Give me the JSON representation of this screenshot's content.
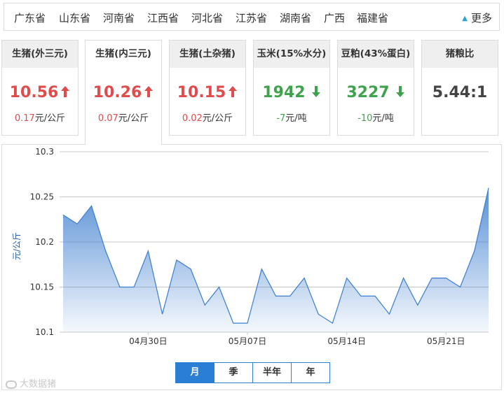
{
  "provinces": [
    "广东省",
    "山东省",
    "河南省",
    "江西省",
    "河北省",
    "江苏省",
    "湖南省",
    "广西",
    "福建省"
  ],
  "more_label": "更多",
  "cards": [
    {
      "title": "生猪(外三元)",
      "price": "10.56",
      "trend": "up",
      "change": "0.17",
      "unit": "元/公斤"
    },
    {
      "title": "生猪(内三元)",
      "price": "10.26",
      "trend": "up",
      "change": "0.07",
      "unit": "元/公斤"
    },
    {
      "title": "生猪(土杂猪)",
      "price": "10.15",
      "trend": "up",
      "change": "0.02",
      "unit": "元/公斤"
    },
    {
      "title": "玉米(15%水分)",
      "price": "1942",
      "trend": "down",
      "change": "-7",
      "unit": "元/吨"
    },
    {
      "title": "豆粕(43%蛋白)",
      "price": "3227",
      "trend": "down",
      "change": "-10",
      "unit": "元/吨"
    },
    {
      "title": "猪粮比",
      "price": "5.44:1",
      "trend": "flat",
      "change": "",
      "unit": ""
    }
  ],
  "active_card": 1,
  "colors": {
    "up": "#e04b4b",
    "down": "#3fa34d",
    "accent": "#2a7fd4",
    "line": "#3b7dcf"
  },
  "chart_data": {
    "type": "area",
    "ylabel": "元/公斤",
    "xlabel": "",
    "ylim": [
      10.1,
      10.3
    ],
    "yticks": [
      "10.3",
      "10.25",
      "10.2",
      "10.15",
      "10.1"
    ],
    "x": [
      "04-24",
      "04-25",
      "04-26",
      "04-27",
      "04-28",
      "04-29",
      "04-30",
      "05-01",
      "05-02",
      "05-03",
      "05-04",
      "05-05",
      "05-06",
      "05-07",
      "05-08",
      "05-09",
      "05-10",
      "05-11",
      "05-12",
      "05-13",
      "05-14",
      "05-15",
      "05-16",
      "05-17",
      "05-18",
      "05-19",
      "05-20",
      "05-21",
      "05-22",
      "05-23",
      "05-24"
    ],
    "xticks": [
      {
        "x": "04-30",
        "label": "04月30日"
      },
      {
        "x": "05-07",
        "label": "05月07日"
      },
      {
        "x": "05-14",
        "label": "05月14日"
      },
      {
        "x": "05-21",
        "label": "05月21日"
      }
    ],
    "series": [
      {
        "values": [
          10.23,
          10.22,
          10.24,
          10.19,
          10.15,
          10.15,
          10.19,
          10.12,
          10.18,
          10.17,
          10.13,
          10.15,
          10.11,
          10.11,
          10.17,
          10.14,
          10.14,
          10.16,
          10.12,
          10.11,
          10.16,
          10.14,
          10.14,
          10.12,
          10.16,
          10.13,
          10.16,
          10.16,
          10.15,
          10.19,
          10.26
        ]
      }
    ],
    "grid": true,
    "legend": "none"
  },
  "range_buttons": [
    "月",
    "季",
    "半年",
    "年"
  ],
  "active_range": 0,
  "watermark": "大数据猪"
}
